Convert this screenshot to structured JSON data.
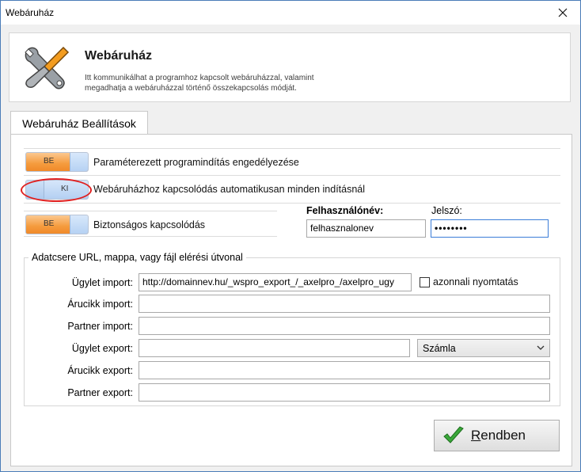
{
  "window": {
    "title": "Webáruház"
  },
  "header": {
    "title": "Webáruház",
    "description": "Itt kommunikálhat a programhoz kapcsolt webáruházzal, valamint megadhatja a webáruházzal történő összekapcsolás módját."
  },
  "tabs": [
    {
      "label": "Webáruház Beállítások",
      "active": true
    }
  ],
  "settings": {
    "param_start": {
      "toggle": "BE",
      "label": "Paraméterezett programindítás engedélyezése"
    },
    "auto_connect": {
      "toggle": "KI",
      "label": "Webáruházhoz kapcsolódás automatikusan minden indításnál"
    },
    "secure": {
      "toggle": "BE",
      "label": "Biztonságos kapcsolódás"
    }
  },
  "login": {
    "username_label": "Felhasználónév:",
    "username_value": "felhasznalonev",
    "password_label": "Jelszó:",
    "password_value": "••••••••"
  },
  "exchange": {
    "group_title": "Adatcsere URL, mappa, vagy fájl elérési útvonal",
    "rows": [
      {
        "label": "Ügylet import:",
        "value": "http://domainnev.hu/_wspro_export_/_axelpro_/axelpro_ugy"
      },
      {
        "label": "Árucikk import:",
        "value": ""
      },
      {
        "label": "Partner import:",
        "value": ""
      },
      {
        "label": "Ügylet export:",
        "value": ""
      },
      {
        "label": "Árucikk export:",
        "value": ""
      },
      {
        "label": "Partner export:",
        "value": ""
      }
    ],
    "instant_print_label": "azonnali nyomtatás",
    "export_type_selected": "Számla"
  },
  "ok_button": {
    "label_first": "R",
    "label_rest": "endben"
  },
  "colors": {
    "toggle_on": "#f59b3d",
    "toggle_off": "#b4d0f2",
    "ok_check": "#3aa83a",
    "highlight_ellipse": "#e02020"
  }
}
